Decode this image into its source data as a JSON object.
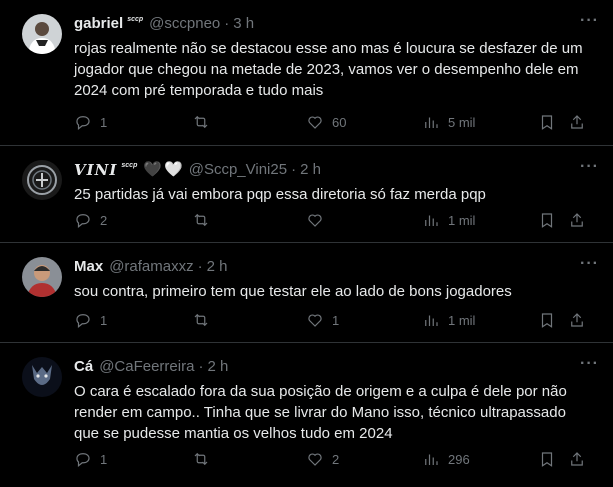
{
  "tweets": [
    {
      "name": "gabriel",
      "badge": "sccp",
      "handle": "@sccpneo",
      "time": "3 h",
      "text": "rojas realmente não se destacou esse ano mas é loucura se desfazer de um jogador que chegou na metade de 2023, vamos ver o desempenho dele em 2024 com pré temporada e tudo mais",
      "replies": "1",
      "retweets": "",
      "likes": "60",
      "views": "5 mil"
    },
    {
      "name": "VINI",
      "badge": "sccp",
      "hearts": [
        "🖤",
        "🤍"
      ],
      "handle": "@Sccp_Vini25",
      "time": "2 h",
      "text": "25 partidas já vai embora pqp essa diretoria só faz merda pqp",
      "replies": "2",
      "retweets": "",
      "likes": "",
      "views": "1 mil"
    },
    {
      "name": "Max",
      "handle": "@rafamaxxz",
      "time": "2 h",
      "text": "sou contra, primeiro tem que testar ele ao lado de bons jogadores",
      "replies": "1",
      "retweets": "",
      "likes": "1",
      "views": "1 mil"
    },
    {
      "name": "Cá",
      "handle": "@CaFeerreira",
      "time": "2 h",
      "text": "O cara é escalado fora da sua posição de origem e a culpa é dele por não render em campo.. Tinha que se livrar do Mano isso, técnico ultrapassado que se pudesse mantia os velhos tudo em 2024",
      "replies": "1",
      "retweets": "",
      "likes": "2",
      "views": "296"
    }
  ],
  "ui": {
    "dot": "·",
    "more": "···"
  },
  "colors": {
    "background": "#000000",
    "text": "#e7e9ea",
    "muted": "#71767b",
    "divider": "#2f3336"
  },
  "icons": [
    "reply-icon",
    "retweet-icon",
    "like-icon",
    "views-icon",
    "bookmark-icon",
    "share-icon",
    "more-icon"
  ]
}
